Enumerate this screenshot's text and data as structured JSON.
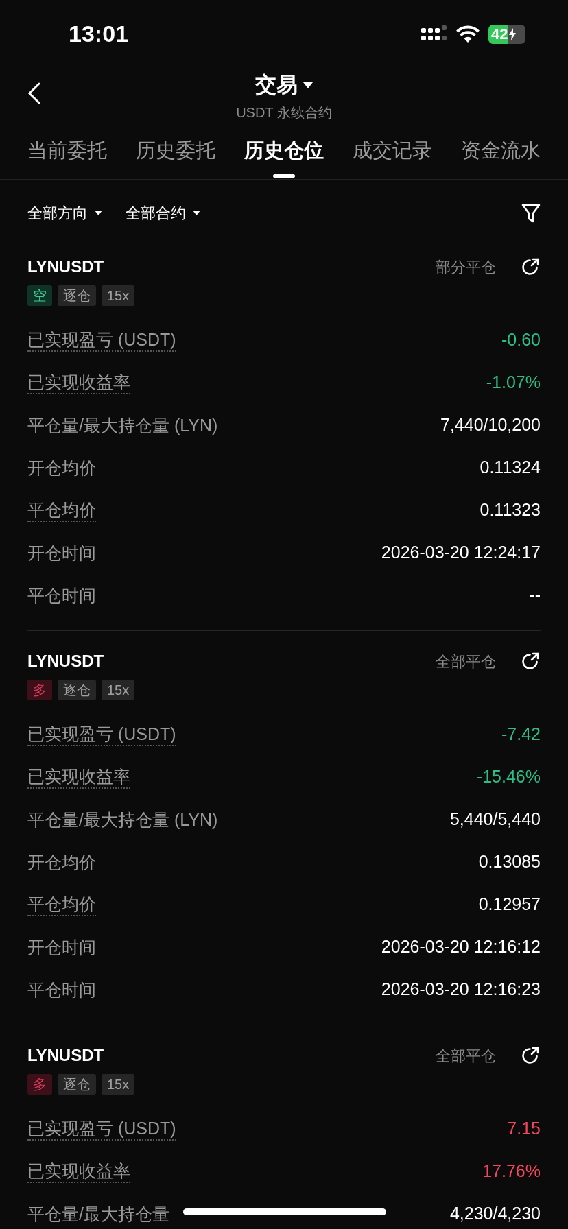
{
  "status_bar": {
    "time": "13:01",
    "battery": "42"
  },
  "header": {
    "title": "交易",
    "subtitle": "USDT 永续合约"
  },
  "tabs": [
    {
      "label": "当前委托",
      "selected": false
    },
    {
      "label": "历史委托",
      "selected": false
    },
    {
      "label": "历史仓位",
      "selected": true
    },
    {
      "label": "成交记录",
      "selected": false
    },
    {
      "label": "资金流水",
      "selected": false
    }
  ],
  "filters": [
    "全部方向",
    "全部合约"
  ],
  "positions": [
    {
      "symbol": "LYNUSDT",
      "status": "部分平仓",
      "side": "空",
      "color": "#0f3326",
      "margin": "逐仓",
      "leverage": "15x",
      "rows": [
        {
          "label": "已实现盈亏 (USDT)",
          "value": "-0.60",
          "hint": true,
          "color": "#2ebd85"
        },
        {
          "label": "已实现收益率",
          "value": "-1.07%",
          "hint": true,
          "color": "#2ebd85"
        },
        {
          "label": "平仓量/最大持仓量 (LYN)",
          "value": "7,440/10,200",
          "hint": false,
          "color": "#ffffff"
        },
        {
          "label": "开仓均价",
          "value": "0.11324",
          "hint": false,
          "color": "#ffffff"
        },
        {
          "label": "平仓均价",
          "value": "0.11323",
          "hint": true,
          "color": "#ffffff"
        },
        {
          "label": "开仓时间",
          "value": "2026-03-20 12:24:17",
          "hint": false,
          "color": "#ffffff"
        },
        {
          "label": "平仓时间",
          "value": "--",
          "hint": false,
          "color": "#ffffff"
        }
      ]
    },
    {
      "symbol": "LYNUSDT",
      "status": "全部平仓",
      "side": "多",
      "color": "#3d0f18",
      "margin": "逐仓",
      "leverage": "15x",
      "rows": [
        {
          "label": "已实现盈亏 (USDT)",
          "value": "-7.42",
          "hint": true,
          "color": "#2ebd85"
        },
        {
          "label": "已实现收益率",
          "value": "-15.46%",
          "hint": true,
          "color": "#2ebd85"
        },
        {
          "label": "平仓量/最大持仓量 (LYN)",
          "value": "5,440/5,440",
          "hint": false,
          "color": "#ffffff"
        },
        {
          "label": "开仓均价",
          "value": "0.13085",
          "hint": false,
          "color": "#ffffff"
        },
        {
          "label": "平仓均价",
          "value": "0.12957",
          "hint": true,
          "color": "#ffffff"
        },
        {
          "label": "开仓时间",
          "value": "2026-03-20 12:16:12",
          "hint": false,
          "color": "#ffffff"
        },
        {
          "label": "平仓时间",
          "value": "2026-03-20 12:16:23",
          "hint": false,
          "color": "#ffffff"
        }
      ]
    },
    {
      "symbol": "LYNUSDT",
      "status": "全部平仓",
      "side": "多",
      "color": "#3d0f18",
      "margin": "逐仓",
      "leverage": "15x",
      "rows": [
        {
          "label": "已实现盈亏 (USDT)",
          "value": "7.15",
          "hint": true,
          "color": "#f6465d"
        },
        {
          "label": "已实现收益率",
          "value": "17.76%",
          "hint": true,
          "color": "#f6465d"
        },
        {
          "label": "平仓量/最大持仓量",
          "value": "4,230/4,230",
          "hint": false,
          "color": "#ffffff"
        }
      ]
    }
  ]
}
